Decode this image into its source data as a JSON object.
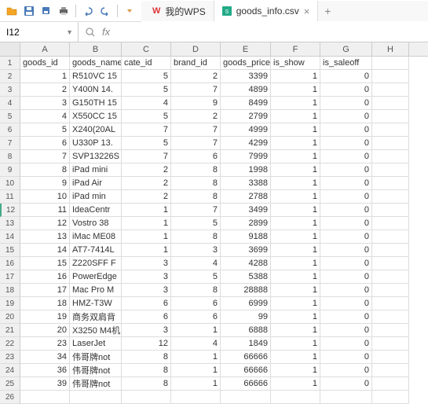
{
  "app": {
    "cell_ref": "I12",
    "tabs": [
      {
        "label": "我的WPS",
        "icon": "wps"
      },
      {
        "label": "goods_info.csv",
        "icon": "csv"
      }
    ]
  },
  "columns": [
    "A",
    "B",
    "C",
    "D",
    "E",
    "F",
    "G",
    "H"
  ],
  "headers": [
    "goods_id",
    "goods_name",
    "cate_id",
    "brand_id",
    "goods_price",
    "is_show",
    "is_saleoff"
  ],
  "rows": [
    {
      "n": 2,
      "id": 1,
      "name": "R510VC 15",
      "cate": 5,
      "brand": 2,
      "price": 3399,
      "show": 1,
      "sale": 0
    },
    {
      "n": 3,
      "id": 2,
      "name": "Y400N 14.",
      "cate": 5,
      "brand": 7,
      "price": 4899,
      "show": 1,
      "sale": 0
    },
    {
      "n": 4,
      "id": 3,
      "name": "G150TH 15",
      "cate": 4,
      "brand": 9,
      "price": 8499,
      "show": 1,
      "sale": 0
    },
    {
      "n": 5,
      "id": 4,
      "name": "X550CC 15",
      "cate": 5,
      "brand": 2,
      "price": 2799,
      "show": 1,
      "sale": 0
    },
    {
      "n": 6,
      "id": 5,
      "name": "X240(20AL",
      "cate": 7,
      "brand": 7,
      "price": 4999,
      "show": 1,
      "sale": 0
    },
    {
      "n": 7,
      "id": 6,
      "name": "U330P 13.",
      "cate": 5,
      "brand": 7,
      "price": 4299,
      "show": 1,
      "sale": 0
    },
    {
      "n": 8,
      "id": 7,
      "name": "SVP13226S",
      "cate": 7,
      "brand": 6,
      "price": 7999,
      "show": 1,
      "sale": 0
    },
    {
      "n": 9,
      "id": 8,
      "name": "iPad mini",
      "cate": 2,
      "brand": 8,
      "price": 1998,
      "show": 1,
      "sale": 0
    },
    {
      "n": 10,
      "id": 9,
      "name": "iPad Air",
      "cate": 2,
      "brand": 8,
      "price": 3388,
      "show": 1,
      "sale": 0
    },
    {
      "n": 11,
      "id": 10,
      "name": " iPad min",
      "cate": 2,
      "brand": 8,
      "price": 2788,
      "show": 1,
      "sale": 0
    },
    {
      "n": 12,
      "id": 11,
      "name": "IdeaCentr",
      "cate": 1,
      "brand": 7,
      "price": 3499,
      "show": 1,
      "sale": 0
    },
    {
      "n": 13,
      "id": 12,
      "name": "Vostro 38",
      "cate": 1,
      "brand": 5,
      "price": 2899,
      "show": 1,
      "sale": 0
    },
    {
      "n": 14,
      "id": 13,
      "name": "iMac ME08",
      "cate": 1,
      "brand": 8,
      "price": 9188,
      "show": 1,
      "sale": 0
    },
    {
      "n": 15,
      "id": 14,
      "name": "AT7-7414L",
      "cate": 1,
      "brand": 3,
      "price": 3699,
      "show": 1,
      "sale": 0
    },
    {
      "n": 16,
      "id": 15,
      "name": "Z220SFF F",
      "cate": 3,
      "brand": 4,
      "price": 4288,
      "show": 1,
      "sale": 0
    },
    {
      "n": 17,
      "id": 16,
      "name": "PowerEdge",
      "cate": 3,
      "brand": 5,
      "price": 5388,
      "show": 1,
      "sale": 0
    },
    {
      "n": 18,
      "id": 17,
      "name": "Mac Pro M",
      "cate": 3,
      "brand": 8,
      "price": 28888,
      "show": 1,
      "sale": 0
    },
    {
      "n": 19,
      "id": 18,
      "name": " HMZ-T3W",
      "cate": 6,
      "brand": 6,
      "price": 6999,
      "show": 1,
      "sale": 0
    },
    {
      "n": 20,
      "id": 19,
      "name": "商务双肩背",
      "cate": 6,
      "brand": 6,
      "price": 99,
      "show": 1,
      "sale": 0
    },
    {
      "n": 21,
      "id": 20,
      "name": "X3250 M4机",
      "cate": 3,
      "brand": 1,
      "price": 6888,
      "show": 1,
      "sale": 0
    },
    {
      "n": 22,
      "id": 23,
      "name": " LaserJet",
      "cate": 12,
      "brand": 4,
      "price": 1849,
      "show": 1,
      "sale": 0
    },
    {
      "n": 23,
      "id": 34,
      "name": "伟哥牌not",
      "cate": 8,
      "brand": 1,
      "price": 66666,
      "show": 1,
      "sale": 0
    },
    {
      "n": 24,
      "id": 36,
      "name": "伟哥牌not",
      "cate": 8,
      "brand": 1,
      "price": 66666,
      "show": 1,
      "sale": 0
    },
    {
      "n": 25,
      "id": 39,
      "name": "伟哥牌not",
      "cate": 8,
      "brand": 1,
      "price": 66666,
      "show": 1,
      "sale": 0
    }
  ]
}
